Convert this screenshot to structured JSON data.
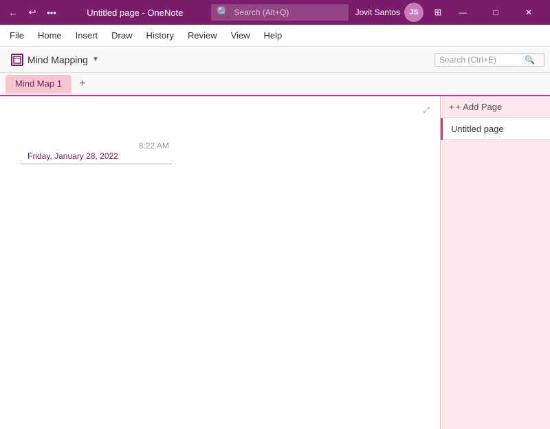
{
  "titleBar": {
    "title": "Untitled page - OneNote",
    "searchPlaceholder": "Search (Alt+Q)",
    "userName": "Jovit Santos",
    "userInitials": "JS",
    "backIcon": "←",
    "undoIcon": "↩",
    "moreIcon": "•••",
    "minimizeIcon": "—",
    "maximizeIcon": "□",
    "closeIcon": "✕",
    "notebookbarIcon": "⊞"
  },
  "menuBar": {
    "items": [
      "File",
      "Home",
      "Insert",
      "Draw",
      "History",
      "Review",
      "View",
      "Help"
    ]
  },
  "notebookBar": {
    "notebookName": "Mind Mapping",
    "dropdownIcon": "▼",
    "searchPlaceholder": "Search (Ctrl+E)",
    "searchIcon": "🔍"
  },
  "tabsBar": {
    "tabs": [
      "Mind Map 1"
    ],
    "activeTab": "Mind Map 1",
    "addIcon": "+"
  },
  "pageContent": {
    "expandIcon": "⤢",
    "date": "Friday, January 28, 2022",
    "time": "8:22 AM"
  },
  "rightSidebar": {
    "addPageLabel": "+ Add Page",
    "addPageIcon": "+",
    "pages": [
      {
        "title": "Untitled page",
        "active": true
      }
    ]
  }
}
